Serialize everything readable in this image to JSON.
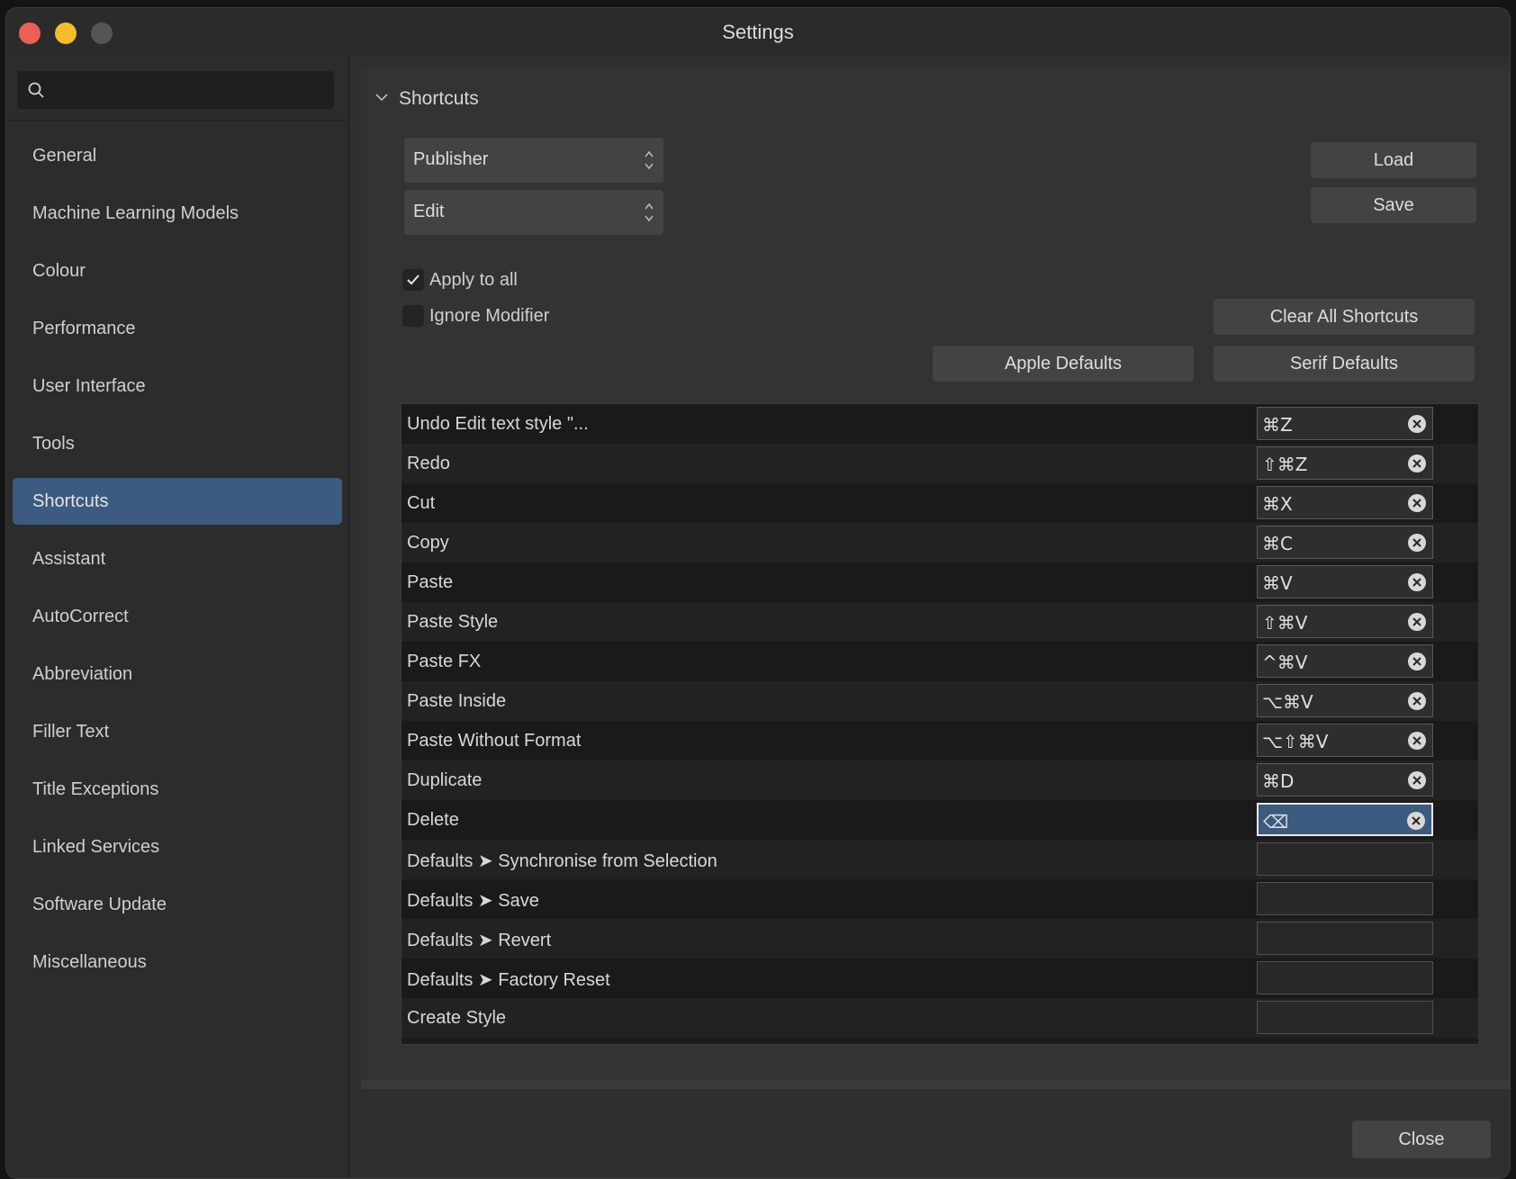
{
  "window": {
    "title": "Settings"
  },
  "search": {
    "placeholder": ""
  },
  "sidebar": {
    "items": [
      {
        "label": "General"
      },
      {
        "label": "Machine Learning Models"
      },
      {
        "label": "Colour"
      },
      {
        "label": "Performance"
      },
      {
        "label": "User Interface"
      },
      {
        "label": "Tools"
      },
      {
        "label": "Shortcuts",
        "selected": true
      },
      {
        "label": "Assistant"
      },
      {
        "label": "AutoCorrect"
      },
      {
        "label": "Abbreviation"
      },
      {
        "label": "Filler Text"
      },
      {
        "label": "Title Exceptions"
      },
      {
        "label": "Linked Services"
      },
      {
        "label": "Software Update"
      },
      {
        "label": "Miscellaneous"
      }
    ]
  },
  "section": {
    "title": "Shortcuts"
  },
  "selects": {
    "app": "Publisher",
    "category": "Edit"
  },
  "buttons": {
    "load": "Load",
    "save": "Save",
    "clear_all": "Clear All Shortcuts",
    "apple_defaults": "Apple Defaults",
    "serif_defaults": "Serif Defaults",
    "close": "Close"
  },
  "checks": {
    "apply_to_all": {
      "label": "Apply to all",
      "checked": true
    },
    "ignore_modifier": {
      "label": "Ignore Modifier",
      "checked": false
    }
  },
  "shortcuts": [
    {
      "command": "Undo Edit text style \"...",
      "key": "⌘Z"
    },
    {
      "command": "Redo",
      "key": "⇧⌘Z"
    },
    {
      "command": "Cut",
      "key": "⌘X"
    },
    {
      "command": "Copy",
      "key": "⌘C"
    },
    {
      "command": "Paste",
      "key": "⌘V"
    },
    {
      "command": "Paste Style",
      "key": "⇧⌘V"
    },
    {
      "command": "Paste FX",
      "key": "^⌘V"
    },
    {
      "command": "Paste Inside",
      "key": "⌥⌘V"
    },
    {
      "command": "Paste Without Format",
      "key": "⌥⇧⌘V"
    },
    {
      "command": "Duplicate",
      "key": "⌘D"
    },
    {
      "command": "Delete",
      "key": "⌫",
      "editing": true
    },
    {
      "command": "Defaults ➤ Synchronise from Selection",
      "key": ""
    },
    {
      "command": "Defaults ➤ Save",
      "key": ""
    },
    {
      "command": "Defaults ➤ Revert",
      "key": ""
    },
    {
      "command": "Defaults ➤ Factory Reset",
      "key": ""
    },
    {
      "command": "Create Style",
      "key": ""
    }
  ],
  "colors": {
    "accent": "#3d5a80",
    "close": "#ec5f57",
    "minimize": "#f3bc2f"
  }
}
